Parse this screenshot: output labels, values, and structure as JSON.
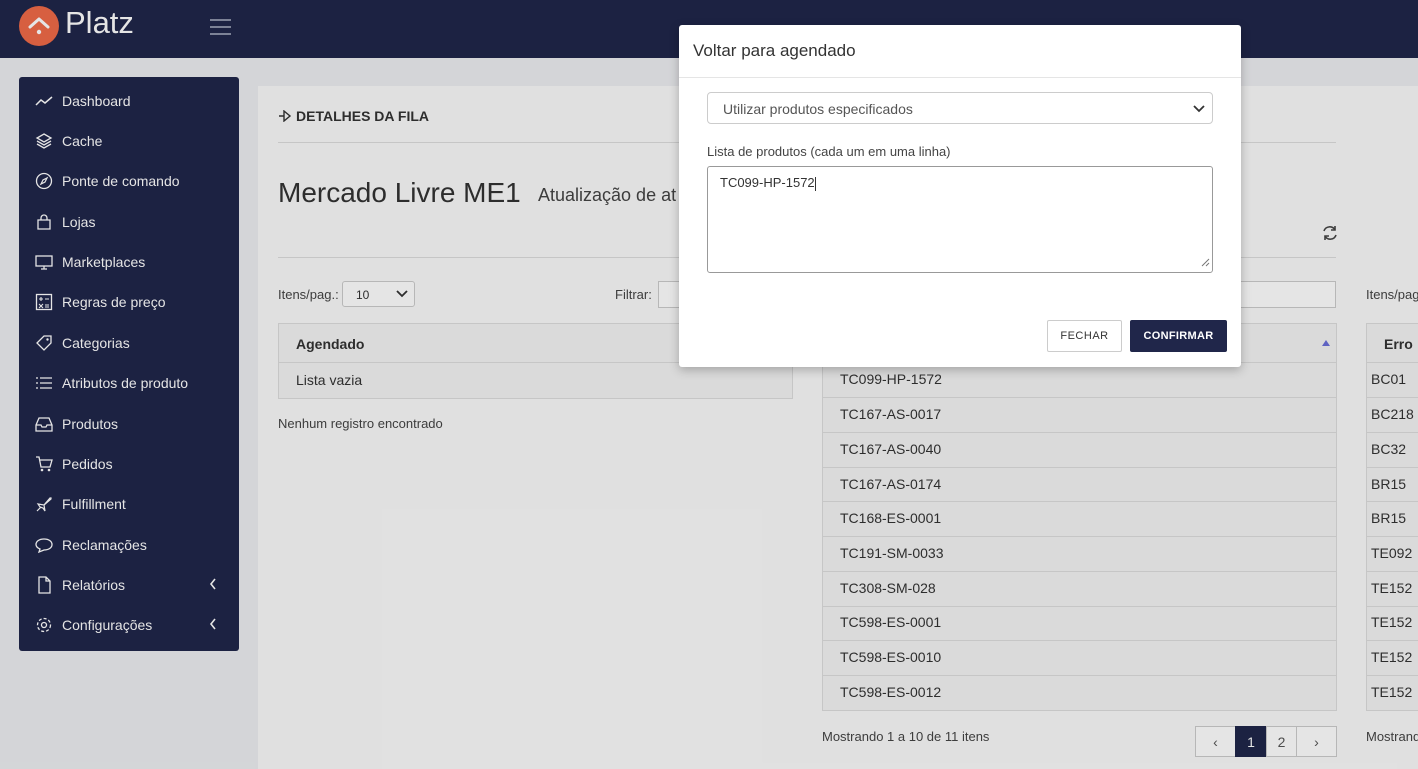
{
  "app": {
    "name": "Platz"
  },
  "sidebar": {
    "items": [
      {
        "label": "Dashboard",
        "icon": "chart-line-icon"
      },
      {
        "label": "Cache",
        "icon": "layers-icon"
      },
      {
        "label": "Ponte de comando",
        "icon": "compass-icon"
      },
      {
        "label": "Lojas",
        "icon": "shopping-bag-icon"
      },
      {
        "label": "Marketplaces",
        "icon": "monitor-icon"
      },
      {
        "label": "Regras de preço",
        "icon": "calculator-icon"
      },
      {
        "label": "Categorias",
        "icon": "tag-icon"
      },
      {
        "label": "Atributos de produto",
        "icon": "list-icon"
      },
      {
        "label": "Produtos",
        "icon": "inbox-icon"
      },
      {
        "label": "Pedidos",
        "icon": "cart-icon"
      },
      {
        "label": "Fulfillment",
        "icon": "plane-icon"
      },
      {
        "label": "Reclamações",
        "icon": "chat-bubble-icon"
      },
      {
        "label": "Relatórios",
        "icon": "file-icon"
      },
      {
        "label": "Configurações",
        "icon": "gear-icon"
      }
    ]
  },
  "page": {
    "section": "DETALHES DA FILA",
    "title": "Mercado Livre ME1",
    "subtitle": "Atualização de at"
  },
  "controls": {
    "items_per_page_label": "Itens/pag.:",
    "items_per_page_value": "10",
    "filter_label": "Filtrar:",
    "items_per_page_label_right": "Itens/pag"
  },
  "table_agendado": {
    "header": "Agendado",
    "rows": [
      "Lista vazia"
    ],
    "footer": "Nenhum registro encontrado"
  },
  "table_products": {
    "sort_icon": "sort-asc-icon",
    "rows": [
      "TC099-HP-1572",
      "TC167-AS-0017",
      "TC167-AS-0040",
      "TC167-AS-0174",
      "TC168-ES-0001",
      "TC191-SM-0033",
      "TC308-SM-028",
      "TC598-ES-0001",
      "TC598-ES-0010",
      "TC598-ES-0012"
    ],
    "footer": "Mostrando 1 a 10 de 11 itens",
    "pagination": {
      "prev": "‹",
      "pages": [
        "1",
        "2"
      ],
      "current": "1",
      "next": "›"
    }
  },
  "table_erro": {
    "header": "Erro",
    "rows": [
      "BC01",
      "BC218",
      "BC32",
      "BR15",
      "BR15",
      "TE092",
      "TE152",
      "TE152",
      "TE152",
      "TE152"
    ],
    "footer": "Mostrand"
  },
  "modal": {
    "title": "Voltar para agendado",
    "select_value": "Utilizar produtos especificados",
    "textarea_label": "Lista de produtos (cada um em uma linha)",
    "textarea_value": "TC099-HP-1572",
    "cancel_label": "FECHAR",
    "confirm_label": "CONFIRMAR"
  },
  "colors": {
    "navy": "#20264a",
    "logo_orange": "#f06a48",
    "sort_arrow": "#6a6fd8"
  }
}
